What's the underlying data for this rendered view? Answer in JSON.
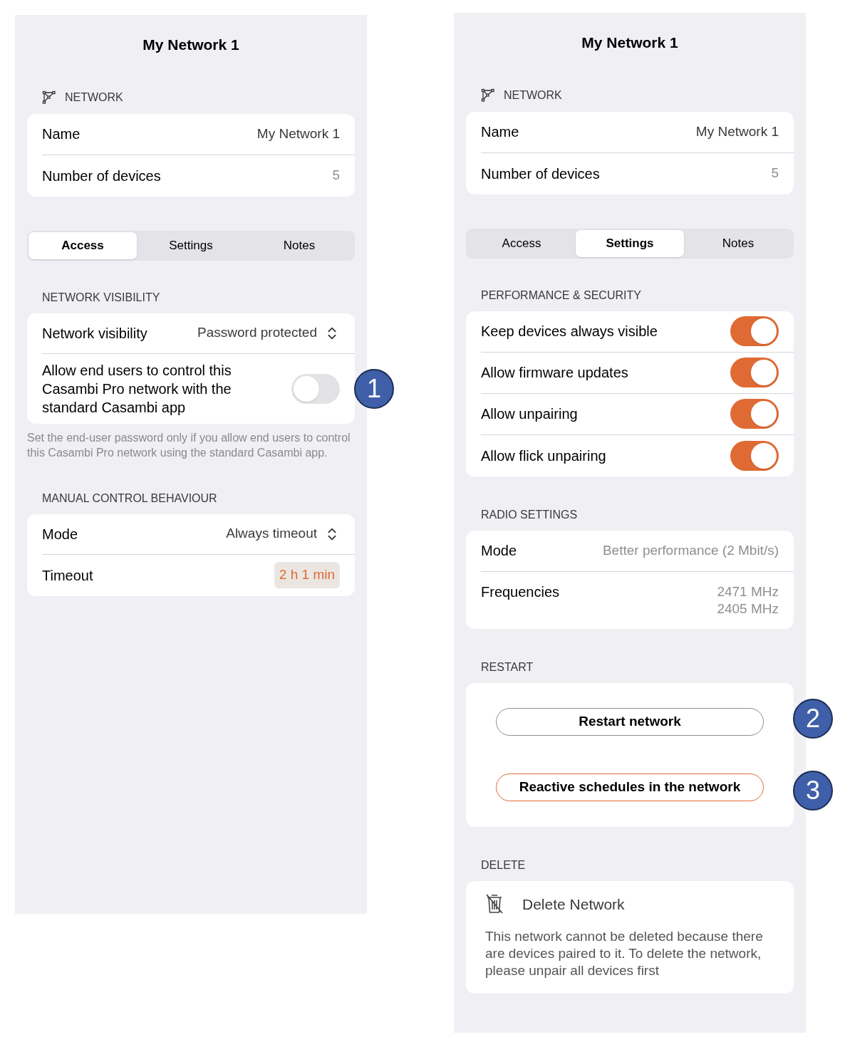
{
  "panels": [
    {
      "title": "My Network 1",
      "network_header": "NETWORK",
      "network_rows": [
        {
          "label": "Name",
          "value": "My Network 1"
        },
        {
          "label": "Number of devices",
          "value": "5"
        }
      ],
      "tabs": [
        {
          "label": "Access",
          "selected": true
        },
        {
          "label": "Settings",
          "selected": false
        },
        {
          "label": "Notes",
          "selected": false
        }
      ],
      "sections": [
        {
          "header": "NETWORK VISIBILITY",
          "rows": [
            {
              "kind": "select",
              "label": "Network visibility",
              "value": "Password protected"
            },
            {
              "kind": "toggle",
              "label": "Allow end users to control this Casambi Pro network with the standard Casambi app",
              "on": false,
              "callout": "1"
            }
          ],
          "footer": "Set the end-user password only if you allow end users to control this Casambi Pro network using the standard Casambi app."
        },
        {
          "header": "MANUAL CONTROL BEHAVIOUR",
          "rows": [
            {
              "kind": "select",
              "label": "Mode",
              "value": "Always timeout"
            },
            {
              "kind": "chip",
              "label": "Timeout",
              "value": "2 h 1 min"
            }
          ]
        }
      ]
    },
    {
      "title": "My Network 1",
      "network_header": "NETWORK",
      "network_rows": [
        {
          "label": "Name",
          "value": "My Network 1"
        },
        {
          "label": "Number of devices",
          "value": "5"
        }
      ],
      "tabs": [
        {
          "label": "Access",
          "selected": false
        },
        {
          "label": "Settings",
          "selected": true
        },
        {
          "label": "Notes",
          "selected": false
        }
      ],
      "sections": [
        {
          "header": "PERFORMANCE & SECURITY",
          "rows": [
            {
              "kind": "toggle",
              "label": "Keep devices always visible",
              "on": true
            },
            {
              "kind": "toggle",
              "label": "Allow firmware updates",
              "on": true
            },
            {
              "kind": "toggle",
              "label": "Allow unpairing",
              "on": true
            },
            {
              "kind": "toggle",
              "label": "Allow flick unpairing",
              "on": true
            }
          ]
        },
        {
          "header": "RADIO SETTINGS",
          "rows": [
            {
              "kind": "value",
              "label": "Mode",
              "values": [
                "Better performance (2 Mbit/s)"
              ]
            },
            {
              "kind": "value",
              "label": "Frequencies",
              "values": [
                "2471 MHz",
                "2405 MHz"
              ]
            }
          ]
        },
        {
          "header": "RESTART",
          "rows": [
            {
              "kind": "button",
              "label": "Restart network",
              "callout": "2"
            },
            {
              "kind": "accent-button",
              "label": "Reactive schedules in the network",
              "callout": "3"
            }
          ]
        },
        {
          "header": "DELETE",
          "rows": [
            {
              "kind": "delete",
              "label": "Delete Network",
              "text": "This network cannot be deleted because there are devices paired to it. To delete the network, please unpair all devices first"
            }
          ]
        }
      ]
    }
  ]
}
